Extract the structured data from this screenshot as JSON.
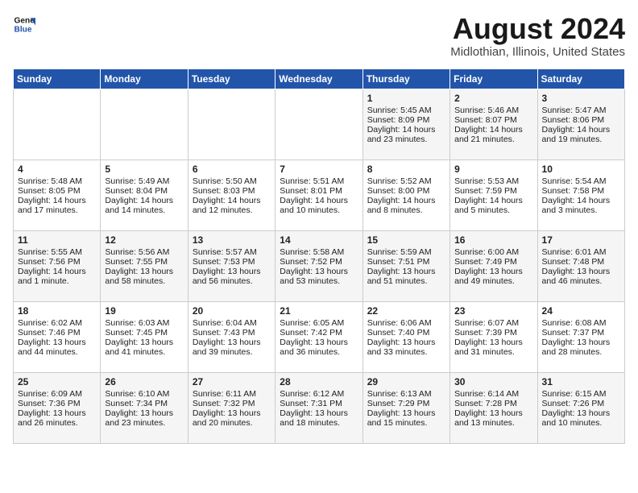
{
  "logo": {
    "line1": "General",
    "line2": "Blue"
  },
  "title": "August 2024",
  "subtitle": "Midlothian, Illinois, United States",
  "weekdays": [
    "Sunday",
    "Monday",
    "Tuesday",
    "Wednesday",
    "Thursday",
    "Friday",
    "Saturday"
  ],
  "weeks": [
    [
      {
        "day": "",
        "content": ""
      },
      {
        "day": "",
        "content": ""
      },
      {
        "day": "",
        "content": ""
      },
      {
        "day": "",
        "content": ""
      },
      {
        "day": "1",
        "content": "Sunrise: 5:45 AM\nSunset: 8:09 PM\nDaylight: 14 hours\nand 23 minutes."
      },
      {
        "day": "2",
        "content": "Sunrise: 5:46 AM\nSunset: 8:07 PM\nDaylight: 14 hours\nand 21 minutes."
      },
      {
        "day": "3",
        "content": "Sunrise: 5:47 AM\nSunset: 8:06 PM\nDaylight: 14 hours\nand 19 minutes."
      }
    ],
    [
      {
        "day": "4",
        "content": "Sunrise: 5:48 AM\nSunset: 8:05 PM\nDaylight: 14 hours\nand 17 minutes."
      },
      {
        "day": "5",
        "content": "Sunrise: 5:49 AM\nSunset: 8:04 PM\nDaylight: 14 hours\nand 14 minutes."
      },
      {
        "day": "6",
        "content": "Sunrise: 5:50 AM\nSunset: 8:03 PM\nDaylight: 14 hours\nand 12 minutes."
      },
      {
        "day": "7",
        "content": "Sunrise: 5:51 AM\nSunset: 8:01 PM\nDaylight: 14 hours\nand 10 minutes."
      },
      {
        "day": "8",
        "content": "Sunrise: 5:52 AM\nSunset: 8:00 PM\nDaylight: 14 hours\nand 8 minutes."
      },
      {
        "day": "9",
        "content": "Sunrise: 5:53 AM\nSunset: 7:59 PM\nDaylight: 14 hours\nand 5 minutes."
      },
      {
        "day": "10",
        "content": "Sunrise: 5:54 AM\nSunset: 7:58 PM\nDaylight: 14 hours\nand 3 minutes."
      }
    ],
    [
      {
        "day": "11",
        "content": "Sunrise: 5:55 AM\nSunset: 7:56 PM\nDaylight: 14 hours\nand 1 minute."
      },
      {
        "day": "12",
        "content": "Sunrise: 5:56 AM\nSunset: 7:55 PM\nDaylight: 13 hours\nand 58 minutes."
      },
      {
        "day": "13",
        "content": "Sunrise: 5:57 AM\nSunset: 7:53 PM\nDaylight: 13 hours\nand 56 minutes."
      },
      {
        "day": "14",
        "content": "Sunrise: 5:58 AM\nSunset: 7:52 PM\nDaylight: 13 hours\nand 53 minutes."
      },
      {
        "day": "15",
        "content": "Sunrise: 5:59 AM\nSunset: 7:51 PM\nDaylight: 13 hours\nand 51 minutes."
      },
      {
        "day": "16",
        "content": "Sunrise: 6:00 AM\nSunset: 7:49 PM\nDaylight: 13 hours\nand 49 minutes."
      },
      {
        "day": "17",
        "content": "Sunrise: 6:01 AM\nSunset: 7:48 PM\nDaylight: 13 hours\nand 46 minutes."
      }
    ],
    [
      {
        "day": "18",
        "content": "Sunrise: 6:02 AM\nSunset: 7:46 PM\nDaylight: 13 hours\nand 44 minutes."
      },
      {
        "day": "19",
        "content": "Sunrise: 6:03 AM\nSunset: 7:45 PM\nDaylight: 13 hours\nand 41 minutes."
      },
      {
        "day": "20",
        "content": "Sunrise: 6:04 AM\nSunset: 7:43 PM\nDaylight: 13 hours\nand 39 minutes."
      },
      {
        "day": "21",
        "content": "Sunrise: 6:05 AM\nSunset: 7:42 PM\nDaylight: 13 hours\nand 36 minutes."
      },
      {
        "day": "22",
        "content": "Sunrise: 6:06 AM\nSunset: 7:40 PM\nDaylight: 13 hours\nand 33 minutes."
      },
      {
        "day": "23",
        "content": "Sunrise: 6:07 AM\nSunset: 7:39 PM\nDaylight: 13 hours\nand 31 minutes."
      },
      {
        "day": "24",
        "content": "Sunrise: 6:08 AM\nSunset: 7:37 PM\nDaylight: 13 hours\nand 28 minutes."
      }
    ],
    [
      {
        "day": "25",
        "content": "Sunrise: 6:09 AM\nSunset: 7:36 PM\nDaylight: 13 hours\nand 26 minutes."
      },
      {
        "day": "26",
        "content": "Sunrise: 6:10 AM\nSunset: 7:34 PM\nDaylight: 13 hours\nand 23 minutes."
      },
      {
        "day": "27",
        "content": "Sunrise: 6:11 AM\nSunset: 7:32 PM\nDaylight: 13 hours\nand 20 minutes."
      },
      {
        "day": "28",
        "content": "Sunrise: 6:12 AM\nSunset: 7:31 PM\nDaylight: 13 hours\nand 18 minutes."
      },
      {
        "day": "29",
        "content": "Sunrise: 6:13 AM\nSunset: 7:29 PM\nDaylight: 13 hours\nand 15 minutes."
      },
      {
        "day": "30",
        "content": "Sunrise: 6:14 AM\nSunset: 7:28 PM\nDaylight: 13 hours\nand 13 minutes."
      },
      {
        "day": "31",
        "content": "Sunrise: 6:15 AM\nSunset: 7:26 PM\nDaylight: 13 hours\nand 10 minutes."
      }
    ]
  ]
}
